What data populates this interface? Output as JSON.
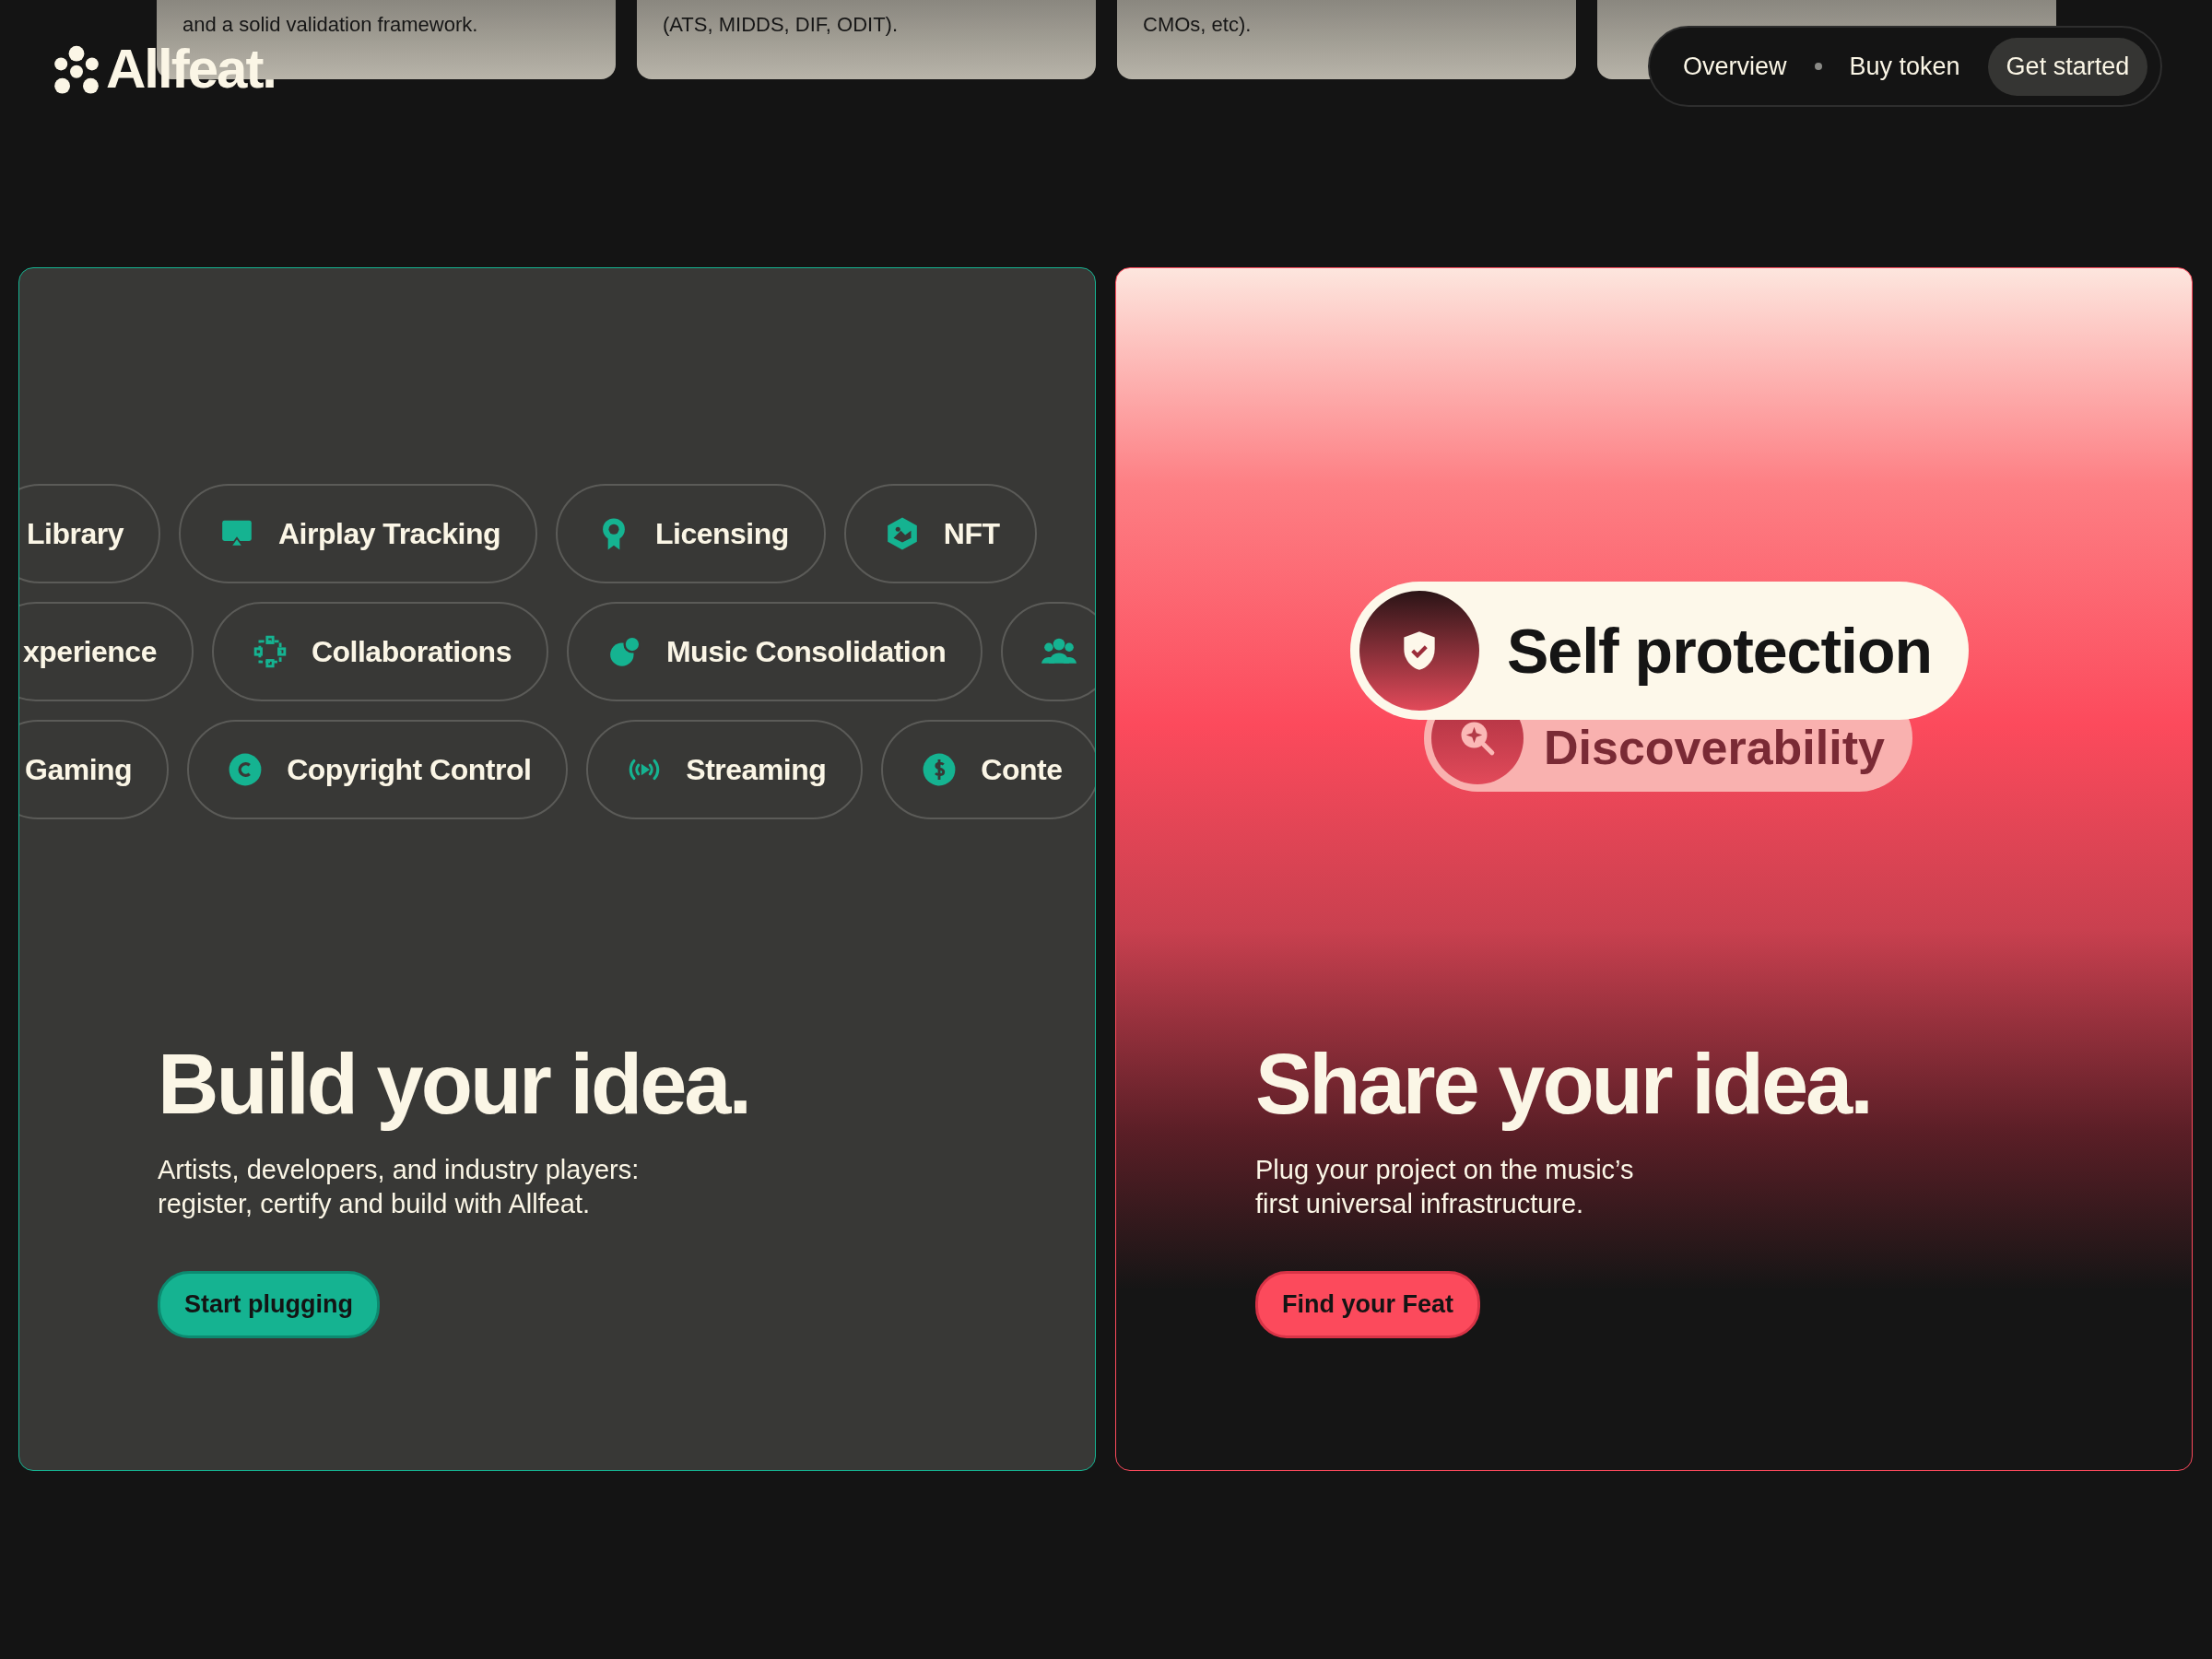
{
  "top_cards": [
    {
      "text": "and a solid validation framework."
    },
    {
      "text": "(ATS, MIDDS, DIF, ODIT)."
    },
    {
      "text": "CMOs, etc)."
    }
  ],
  "logo": {
    "text": "Allfeat."
  },
  "nav": {
    "links": [
      "Overview",
      "Buy token"
    ],
    "cta": "Get started"
  },
  "build_panel": {
    "chip_rows": [
      [
        {
          "label": "Library"
        },
        {
          "label": "Airplay Tracking"
        },
        {
          "label": "Licensing"
        },
        {
          "label": "NFT"
        }
      ],
      [
        {
          "label": "xperience"
        },
        {
          "label": "Collaborations"
        },
        {
          "label": "Music Consolidation"
        },
        {}
      ],
      [
        {
          "label": "Gaming"
        },
        {
          "label": "Copyright Control"
        },
        {
          "label": "Streaming"
        },
        {
          "label": "Conte"
        }
      ]
    ],
    "title": "Build your idea.",
    "text_lines": [
      "Artists, developers, and industry players:",
      "register, certify and build with Allfeat."
    ],
    "button": "Start plugging"
  },
  "share_panel": {
    "pills": [
      {
        "label": "Self protection",
        "selected": true
      },
      {
        "label": "Discoverability",
        "selected": false
      }
    ],
    "title": "Share your idea.",
    "text_lines": [
      "Plug your project on the music’s",
      "first universal infrastructure."
    ],
    "button": "Find your Feat"
  }
}
